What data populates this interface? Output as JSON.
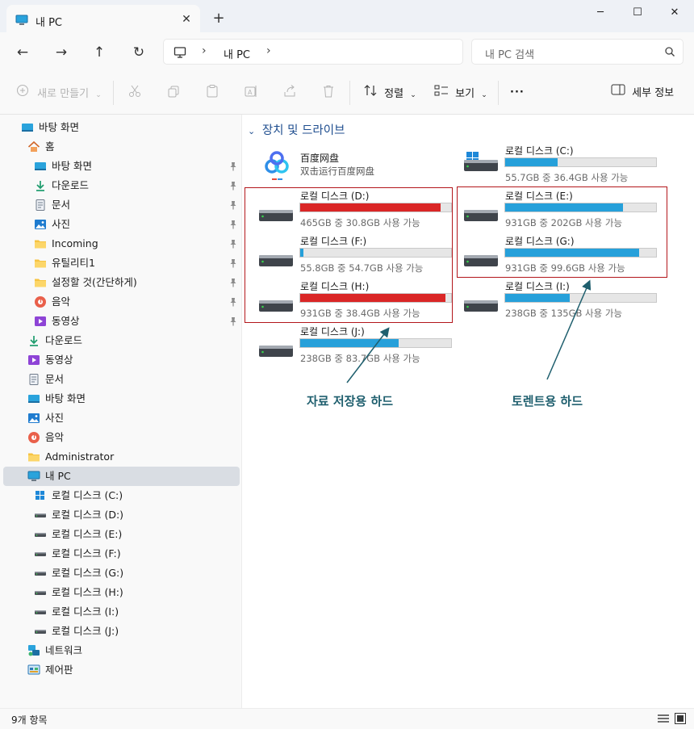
{
  "window": {
    "tab_title": "내 PC",
    "tab_close": "✕",
    "new_tab": "+",
    "minimize": "─",
    "maximize": "☐",
    "close": "✕"
  },
  "nav": {
    "back": "←",
    "forward": "→",
    "up": "↑",
    "refresh": "↻",
    "breadcrumb_sep": "›",
    "breadcrumb": "내 PC",
    "search_placeholder": "내 PC 검색"
  },
  "commands": {
    "new": "새로 만들기",
    "sort": "정렬",
    "view": "보기",
    "more": "···",
    "details": "세부 정보"
  },
  "sidebar": {
    "items": [
      {
        "label": "바탕 화면",
        "icon": "desktop-icon",
        "pinned": false
      },
      {
        "label": "홈",
        "icon": "home-icon",
        "pinned": false
      },
      {
        "label": "바탕 화면",
        "icon": "desktop-icon",
        "pinned": true
      },
      {
        "label": "다운로드",
        "icon": "download-icon",
        "pinned": true
      },
      {
        "label": "문서",
        "icon": "document-icon",
        "pinned": true
      },
      {
        "label": "사진",
        "icon": "pictures-icon",
        "pinned": true
      },
      {
        "label": "Incoming",
        "icon": "folder-icon",
        "pinned": true
      },
      {
        "label": "유틸리티1",
        "icon": "folder-icon",
        "pinned": true
      },
      {
        "label": "설정할 것(간단하게)",
        "icon": "folder-icon",
        "pinned": true
      },
      {
        "label": "음악",
        "icon": "music-icon",
        "pinned": true
      },
      {
        "label": "동영상",
        "icon": "video-icon",
        "pinned": true
      },
      {
        "label": "다운로드",
        "icon": "download-icon",
        "pinned": false
      },
      {
        "label": "동영상",
        "icon": "video-icon",
        "pinned": false
      },
      {
        "label": "문서",
        "icon": "document-icon",
        "pinned": false
      },
      {
        "label": "바탕 화면",
        "icon": "desktop-icon",
        "pinned": false
      },
      {
        "label": "사진",
        "icon": "pictures-icon",
        "pinned": false
      },
      {
        "label": "음악",
        "icon": "music-icon",
        "pinned": false
      },
      {
        "label": "Administrator",
        "icon": "folder-icon",
        "pinned": false
      },
      {
        "label": "내 PC",
        "icon": "pc-icon",
        "pinned": false,
        "selected": true
      },
      {
        "label": "로컬 디스크 (C:)",
        "icon": "windows-drive-icon",
        "pinned": false
      },
      {
        "label": "로컬 디스크 (D:)",
        "icon": "drive-icon",
        "pinned": false
      },
      {
        "label": "로컬 디스크 (E:)",
        "icon": "drive-icon",
        "pinned": false
      },
      {
        "label": "로컬 디스크 (F:)",
        "icon": "drive-icon",
        "pinned": false
      },
      {
        "label": "로컬 디스크 (G:)",
        "icon": "drive-icon",
        "pinned": false
      },
      {
        "label": "로컬 디스크 (H:)",
        "icon": "drive-icon",
        "pinned": false
      },
      {
        "label": "로컬 디스크 (I:)",
        "icon": "drive-icon",
        "pinned": false
      },
      {
        "label": "로컬 디스크 (J:)",
        "icon": "drive-icon",
        "pinned": false
      },
      {
        "label": "네트워크",
        "icon": "network-icon",
        "pinned": false
      },
      {
        "label": "제어판",
        "icon": "control-panel-icon",
        "pinned": false
      }
    ]
  },
  "content": {
    "section_title": "장치 및 드라이브",
    "baidu": {
      "name": "百度网盘",
      "subtitle": "双击运行百度网盘"
    },
    "drives": [
      {
        "name": "로컬 디스크 (C:)",
        "free": "55.7GB 중 36.4GB 사용 가능",
        "used_fraction": 0.35,
        "color": "#26a0da",
        "icon": "windows-drive-icon"
      },
      {
        "name": "로컬 디스크 (D:)",
        "free": "465GB 중 30.8GB 사용 가능",
        "used_fraction": 0.93,
        "color": "#da2626",
        "icon": "drive-icon"
      },
      {
        "name": "로컬 디스크 (E:)",
        "free": "931GB 중 202GB 사용 가능",
        "used_fraction": 0.78,
        "color": "#26a0da",
        "icon": "drive-icon"
      },
      {
        "name": "로컬 디스크 (F:)",
        "free": "55.8GB 중 54.7GB 사용 가능",
        "used_fraction": 0.02,
        "color": "#26a0da",
        "icon": "drive-icon"
      },
      {
        "name": "로컬 디스크 (G:)",
        "free": "931GB 중 99.6GB 사용 가능",
        "used_fraction": 0.89,
        "color": "#26a0da",
        "icon": "drive-icon"
      },
      {
        "name": "로컬 디스크 (H:)",
        "free": "931GB 중 38.4GB 사용 가능",
        "used_fraction": 0.96,
        "color": "#da2626",
        "icon": "drive-icon"
      },
      {
        "name": "로컬 디스크 (I:)",
        "free": "238GB 중 135GB 사용 가능",
        "used_fraction": 0.43,
        "color": "#26a0da",
        "icon": "drive-icon"
      },
      {
        "name": "로컬 디스크 (J:)",
        "free": "238GB 중 83.7GB 사용 가능",
        "used_fraction": 0.65,
        "color": "#26a0da",
        "icon": "drive-icon"
      }
    ],
    "annotations": {
      "storage": "자료 저장용 하드",
      "torrent": "토렌트용 하드"
    }
  },
  "status": {
    "count": "9개 항목"
  },
  "colors": {
    "accent": "#1f4e8f",
    "bar_normal": "#26a0da",
    "bar_full": "#da2626",
    "annotation_box": "#b3161b",
    "annotation_text": "#1f5f6e"
  }
}
